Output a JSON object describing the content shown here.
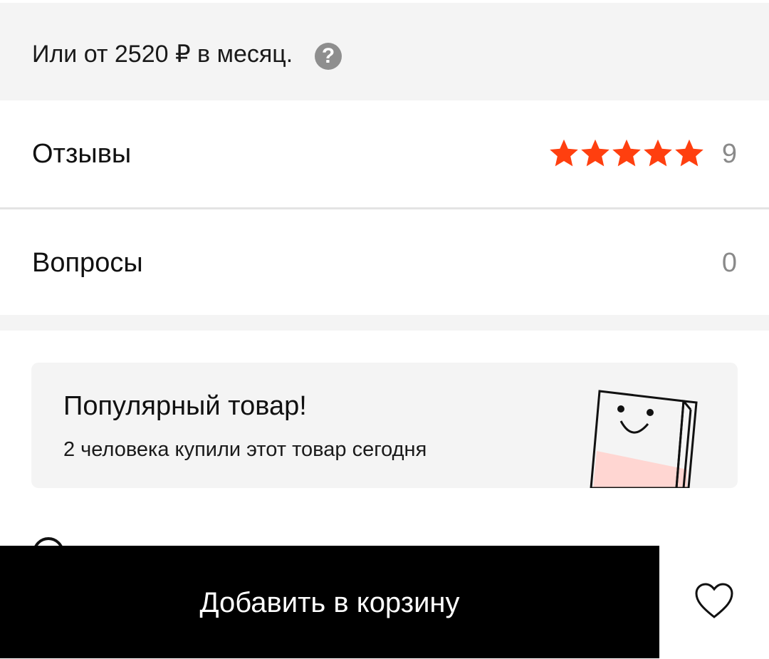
{
  "installment": {
    "text": "Или от 2520 ₽ в месяц.",
    "help_glyph": "?",
    "help_icon": "question-circle-icon",
    "icon_color": "#8e8e8e"
  },
  "reviews": {
    "label": "Отзывы",
    "rating_stars": 5,
    "rating_max": 5,
    "count": "9",
    "star_color": "#ff3f0f"
  },
  "questions": {
    "label": "Вопросы",
    "count": "0"
  },
  "popular": {
    "title": "Популярный товар!",
    "subtitle": "2 человека купили этот товар сегодня",
    "illustration": "smiling-shopping-bag-icon"
  },
  "bottom_bar": {
    "add_to_cart_label": "Добавить в корзину",
    "favorite_icon": "heart-outline-icon"
  }
}
